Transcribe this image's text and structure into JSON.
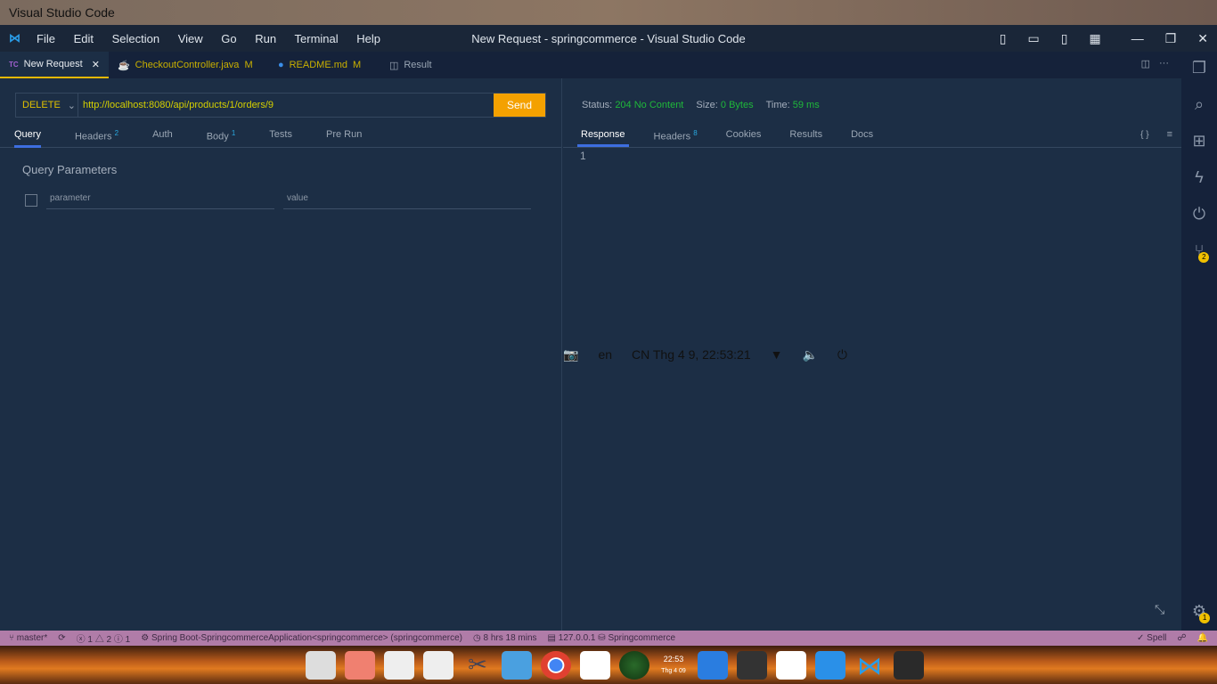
{
  "os": {
    "app": "Visual Studio Code",
    "lang": "en",
    "clock": "CN Thg 4  9, 22:53:21"
  },
  "window": {
    "title": "New Request - springcommerce - Visual Studio Code",
    "menu": [
      "File",
      "Edit",
      "Selection",
      "View",
      "Go",
      "Run",
      "Terminal",
      "Help"
    ]
  },
  "tabs": [
    {
      "label": "New Request",
      "icon": "TC"
    },
    {
      "label": "CheckoutController.java",
      "badge": "M"
    },
    {
      "label": "README.md",
      "badge": "M"
    },
    {
      "label": "Result"
    }
  ],
  "request": {
    "method": "DELETE",
    "url": "http://localhost:8080/api/products/1/orders/9",
    "send": "Send",
    "tabs": [
      {
        "label": "Query"
      },
      {
        "label": "Headers",
        "count": "2"
      },
      {
        "label": "Auth"
      },
      {
        "label": "Body",
        "count": "1"
      },
      {
        "label": "Tests"
      },
      {
        "label": "Pre Run"
      }
    ],
    "query_title": "Query Parameters",
    "param_placeholder": "parameter",
    "value_placeholder": "value"
  },
  "response": {
    "status_label": "Status:",
    "status": "204 No Content",
    "size_label": "Size:",
    "size": "0 Bytes",
    "time_label": "Time:",
    "time": "59 ms",
    "tabs": [
      {
        "label": "Response"
      },
      {
        "label": "Headers",
        "count": "8"
      },
      {
        "label": "Cookies"
      },
      {
        "label": "Results"
      },
      {
        "label": "Docs"
      }
    ],
    "braces": "{ }",
    "line": "1"
  },
  "activity": {
    "scm_badge": "2",
    "settings_badge": "1"
  },
  "status": {
    "branch": "master*",
    "errors": "1",
    "warnings": "2",
    "infos": "1",
    "spring": "Spring Boot-SpringcommerceApplication<springcommerce> (springcommerce)",
    "time": "8 hrs 18 mins",
    "host": "127.0.0.1",
    "db": "Springcommerce",
    "spell": "Spell"
  },
  "dock": {
    "clock_time": "22:53",
    "clock_date": "Thg 4 09"
  }
}
